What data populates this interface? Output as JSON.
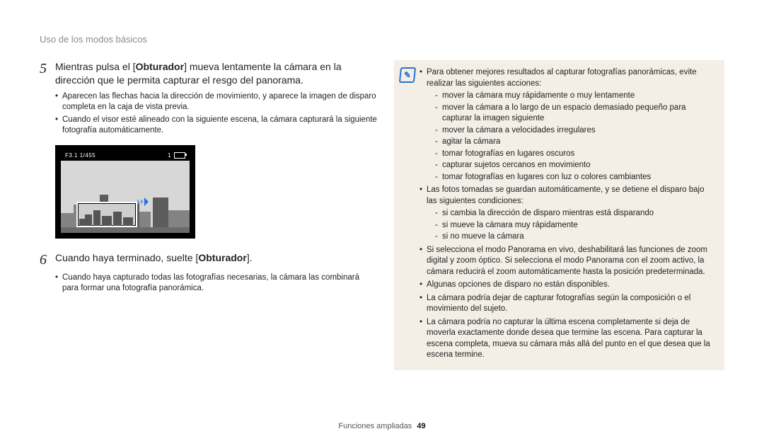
{
  "header": "Uso de los modos básicos",
  "step5": {
    "num": "5",
    "text_pre": "Mientras pulsa el [",
    "text_bold1": "Obturador",
    "text_mid": "] mueva lentamente la cámara en la dirección que le permita capturar el resgo del panorama.",
    "bullets": [
      "Aparecen las flechas hacia la dirección de movimiento, y aparece la imagen de disparo completa en la caja de vista previa.",
      "Cuando el visor esté alineado con la siguiente escena, la cámara capturará la siguiente fotografía automáticamente."
    ]
  },
  "preview": {
    "status": "F3.1 1/455"
  },
  "step6": {
    "num": "6",
    "text_pre": "Cuando haya terminado, suelte [",
    "text_bold": "Obturador",
    "text_post": "].",
    "bullets": [
      "Cuando haya capturado todas las fotografías necesarias, la cámara las combinará para formar una fotografía panorámica."
    ]
  },
  "note": {
    "items": [
      {
        "text": "Para obtener mejores resultados al capturar fotografías panorámicas, evite realizar las siguientes acciones:",
        "sub": [
          "mover la cámara muy rápidamente o muy lentamente",
          "mover la cámara a lo largo de un espacio demasiado pequeño para capturar la imagen siguiente",
          "mover la cámara a velocidades irregulares",
          "agitar la cámara",
          "tomar fotografías en lugares oscuros",
          "capturar sujetos cercanos en movimiento",
          "tomar fotografías en lugares con luz o colores cambiantes"
        ]
      },
      {
        "text": "Las fotos tomadas se guardan automáticamente, y se detiene el disparo bajo las siguientes condiciones:",
        "sub": [
          "si cambia la dirección de disparo mientras está disparando",
          "si mueve la cámara muy rápidamente",
          "si no mueve la cámara"
        ]
      },
      {
        "text": "Si selecciona el modo Panorama en vivo, deshabilitará las funciones de zoom digital y zoom óptico. Si selecciona el modo Panorama con el zoom activo, la cámara reducirá el zoom automáticamente hasta la posición predeterminada."
      },
      {
        "text": "Algunas opciones de disparo no están disponibles."
      },
      {
        "text": "La cámara podría dejar de capturar fotografías según la composición o el movimiento del sujeto."
      },
      {
        "text": "La cámara podría no capturar la última escena completamente si deja de moverla exactamente donde desea que termine las escena. Para capturar la escena completa, mueva su cámara más allá del punto en el que desea que la escena termine."
      }
    ]
  },
  "footer": {
    "section": "Funciones ampliadas",
    "page": "49"
  }
}
